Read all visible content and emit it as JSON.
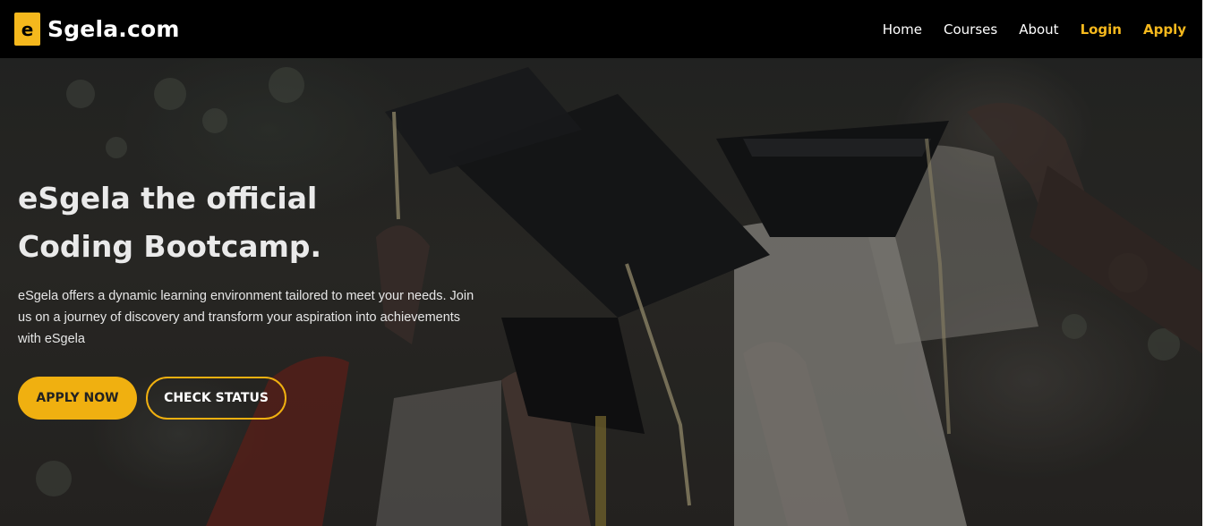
{
  "brand": {
    "logo_letter": "e",
    "name": "Sgela.com",
    "accent_color": "#f5b81d"
  },
  "nav": {
    "home": "Home",
    "courses": "Courses",
    "about": "About",
    "login": "Login",
    "apply": "Apply"
  },
  "hero": {
    "title": "eSgela the official Coding Bootcamp.",
    "text": "eSgela offers a dynamic learning environment tailored to meet your needs. Join us on a journey of discovery and transform your aspiration into achievements with eSgela",
    "apply_button": "APPLY NOW",
    "status_button": "CHECK STATUS",
    "background_image": "graduation-caps-tossed"
  }
}
